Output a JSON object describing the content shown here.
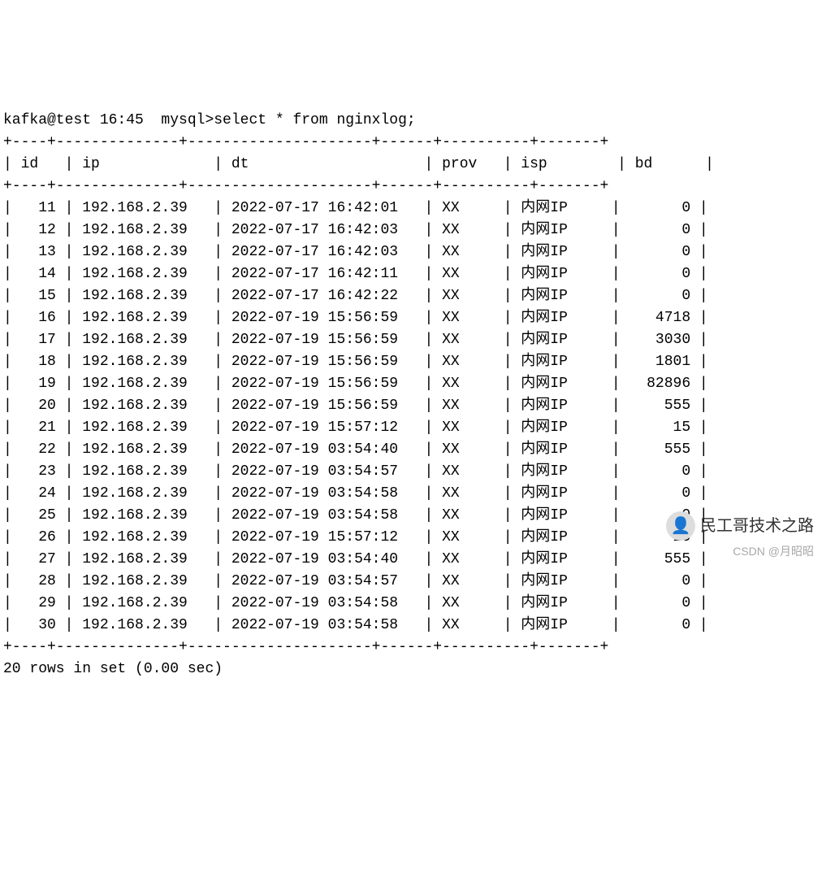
{
  "prompt": "kafka@test 16:45  mysql>select * from nginxlog;",
  "columns": [
    "id",
    "ip",
    "dt",
    "prov",
    "isp",
    "bd"
  ],
  "rows": [
    {
      "id": 11,
      "ip": "192.168.2.39",
      "dt": "2022-07-17 16:42:01",
      "prov": "XX",
      "isp": "内网IP",
      "bd": 0
    },
    {
      "id": 12,
      "ip": "192.168.2.39",
      "dt": "2022-07-17 16:42:03",
      "prov": "XX",
      "isp": "内网IP",
      "bd": 0
    },
    {
      "id": 13,
      "ip": "192.168.2.39",
      "dt": "2022-07-17 16:42:03",
      "prov": "XX",
      "isp": "内网IP",
      "bd": 0
    },
    {
      "id": 14,
      "ip": "192.168.2.39",
      "dt": "2022-07-17 16:42:11",
      "prov": "XX",
      "isp": "内网IP",
      "bd": 0
    },
    {
      "id": 15,
      "ip": "192.168.2.39",
      "dt": "2022-07-17 16:42:22",
      "prov": "XX",
      "isp": "内网IP",
      "bd": 0
    },
    {
      "id": 16,
      "ip": "192.168.2.39",
      "dt": "2022-07-19 15:56:59",
      "prov": "XX",
      "isp": "内网IP",
      "bd": 4718
    },
    {
      "id": 17,
      "ip": "192.168.2.39",
      "dt": "2022-07-19 15:56:59",
      "prov": "XX",
      "isp": "内网IP",
      "bd": 3030
    },
    {
      "id": 18,
      "ip": "192.168.2.39",
      "dt": "2022-07-19 15:56:59",
      "prov": "XX",
      "isp": "内网IP",
      "bd": 1801
    },
    {
      "id": 19,
      "ip": "192.168.2.39",
      "dt": "2022-07-19 15:56:59",
      "prov": "XX",
      "isp": "内网IP",
      "bd": 82896
    },
    {
      "id": 20,
      "ip": "192.168.2.39",
      "dt": "2022-07-19 15:56:59",
      "prov": "XX",
      "isp": "内网IP",
      "bd": 555
    },
    {
      "id": 21,
      "ip": "192.168.2.39",
      "dt": "2022-07-19 15:57:12",
      "prov": "XX",
      "isp": "内网IP",
      "bd": 15
    },
    {
      "id": 22,
      "ip": "192.168.2.39",
      "dt": "2022-07-19 03:54:40",
      "prov": "XX",
      "isp": "内网IP",
      "bd": 555
    },
    {
      "id": 23,
      "ip": "192.168.2.39",
      "dt": "2022-07-19 03:54:57",
      "prov": "XX",
      "isp": "内网IP",
      "bd": 0
    },
    {
      "id": 24,
      "ip": "192.168.2.39",
      "dt": "2022-07-19 03:54:58",
      "prov": "XX",
      "isp": "内网IP",
      "bd": 0
    },
    {
      "id": 25,
      "ip": "192.168.2.39",
      "dt": "2022-07-19 03:54:58",
      "prov": "XX",
      "isp": "内网IP",
      "bd": 0
    },
    {
      "id": 26,
      "ip": "192.168.2.39",
      "dt": "2022-07-19 15:57:12",
      "prov": "XX",
      "isp": "内网IP",
      "bd": 15
    },
    {
      "id": 27,
      "ip": "192.168.2.39",
      "dt": "2022-07-19 03:54:40",
      "prov": "XX",
      "isp": "内网IP",
      "bd": 555
    },
    {
      "id": 28,
      "ip": "192.168.2.39",
      "dt": "2022-07-19 03:54:57",
      "prov": "XX",
      "isp": "内网IP",
      "bd": 0
    },
    {
      "id": 29,
      "ip": "192.168.2.39",
      "dt": "2022-07-19 03:54:58",
      "prov": "XX",
      "isp": "内网IP",
      "bd": 0
    },
    {
      "id": 30,
      "ip": "192.168.2.39",
      "dt": "2022-07-19 03:54:58",
      "prov": "XX",
      "isp": "内网IP",
      "bd": 0
    }
  ],
  "footer": "20 rows in set (0.00 sec)",
  "watermark_label": "民工哥技术之路",
  "csdn_label": "CSDN @月昭昭",
  "col_widths": {
    "id": 4,
    "ip": 14,
    "dt": 21,
    "prov": 6,
    "isp": 10,
    "bd": 7
  },
  "border": "+----+--------------+---------------------+------+----------+-------+"
}
